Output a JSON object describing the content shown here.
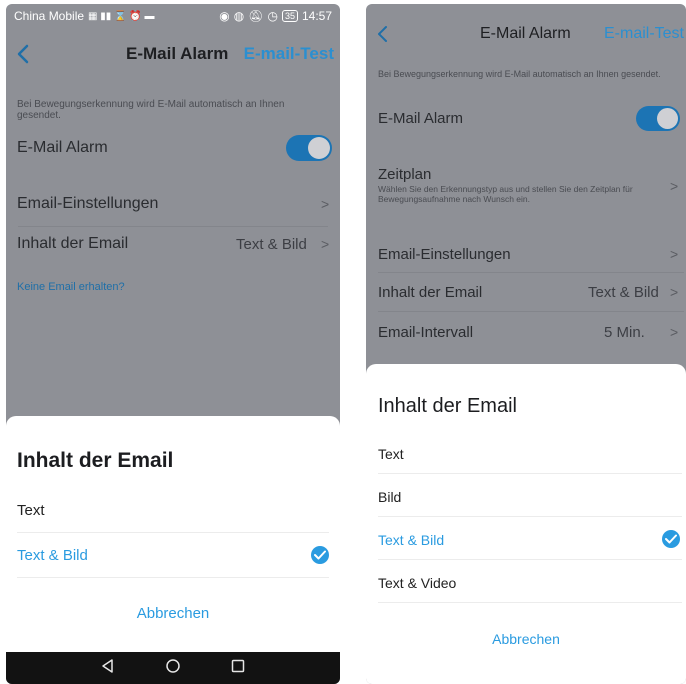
{
  "left": {
    "statusbar": {
      "carrier": "China Mobile",
      "icons": [
        "hd-icon",
        "signal-icon",
        "hourglass-icon",
        "alarm-icon",
        "message-icon"
      ],
      "right_icons": [
        "eye-icon",
        "nfc-icon",
        "mute-icon",
        "alarm-clock-icon"
      ],
      "battery": "35",
      "time": "14:57"
    },
    "header": {
      "title": "E-Mail Alarm",
      "action": "E-mail-Test"
    },
    "description": "Bei Bewegungserkennung wird E-Mail automatisch an Ihnen gesendet.",
    "alarm_label": "E-Mail Alarm",
    "alarm_enabled": true,
    "settings_label": "Email-Einstellungen",
    "content_label": "Inhalt der Email",
    "content_value": "Text & Bild",
    "no_email_link": "Keine Email erhalten?",
    "sheet": {
      "title": "Inhalt der Email",
      "options": [
        {
          "label": "Text",
          "selected": false
        },
        {
          "label": "Text & Bild",
          "selected": true
        }
      ],
      "cancel": "Abbrechen"
    },
    "sysnav": [
      "back-icon",
      "home-icon",
      "recents-icon"
    ]
  },
  "right": {
    "header": {
      "title": "E-Mail Alarm",
      "action": "E-mail-Test"
    },
    "description": "Bei Bewegungserkennung wird E-Mail automatisch an Ihnen gesendet.",
    "alarm_label": "E-Mail Alarm",
    "alarm_enabled": true,
    "schedule_label": "Zeitplan",
    "schedule_desc": "Wählen Sie den Erkennungstyp aus und stellen Sie den Zeitplan für Bewegungsaufnahme nach Wunsch ein.",
    "settings_label": "Email-Einstellungen",
    "content_label": "Inhalt der Email",
    "content_value": "Text & Bild",
    "interval_label": "Email-Intervall",
    "interval_value": "5 Min.",
    "sheet": {
      "title": "Inhalt der Email",
      "options": [
        {
          "label": "Text",
          "selected": false
        },
        {
          "label": "Bild",
          "selected": false
        },
        {
          "label": "Text & Bild",
          "selected": true
        },
        {
          "label": "Text & Video",
          "selected": false
        }
      ],
      "cancel": "Abbrechen"
    }
  },
  "colors": {
    "accent": "#2a9be0",
    "toggle_on": "#1c74b4",
    "dim_background": "#8e9096",
    "sheet_background": "#ffffff"
  }
}
